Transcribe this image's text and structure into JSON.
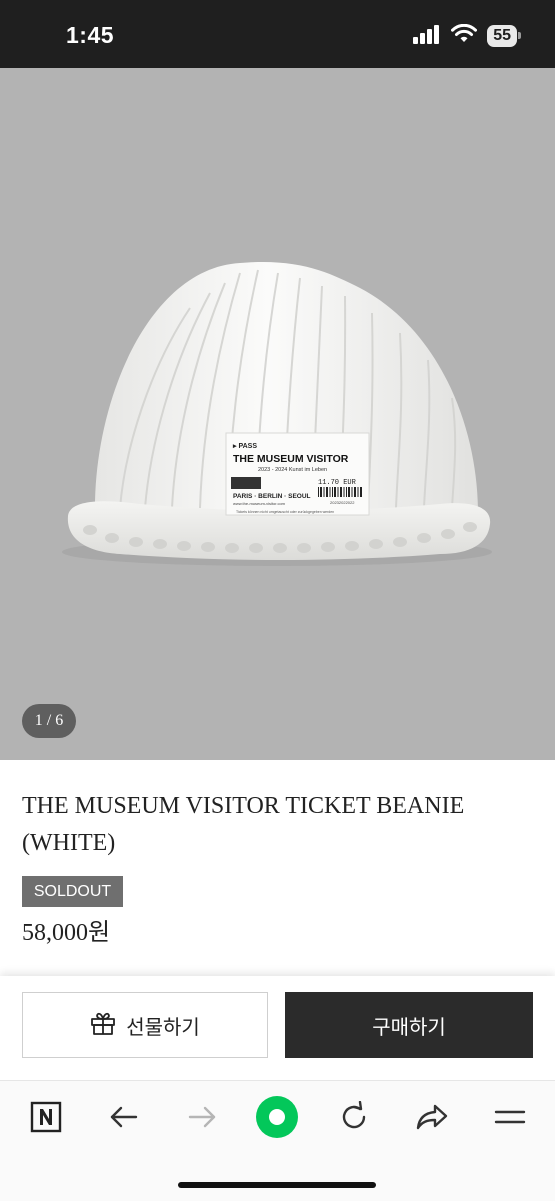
{
  "status_bar": {
    "time": "1:45",
    "battery": "55",
    "icons": [
      "cellular-signal-icon",
      "wifi-icon",
      "battery-icon"
    ]
  },
  "gallery": {
    "counter": "1 / 6",
    "label_text": {
      "pass": "▸ PASS",
      "title": "THE MUSEUM VISITOR",
      "subtitle": "2023 - 2024  Kunst im Leben",
      "price": "11.70  EUR",
      "cities": "PARIS · BERLIN · SEOUL",
      "url": "www.the-museum-visitor.com",
      "code": "20232022022",
      "fine_print": "Tickets können nicht umgetauscht oder zurückgegeben werden"
    }
  },
  "product": {
    "title": "THE MUSEUM VISITOR TICKET BEANIE (WHITE)",
    "badge": "SOLDOUT",
    "price": "58,000원"
  },
  "actions": {
    "gift_label": "선물하기",
    "buy_label": "구매하기"
  },
  "browser_toolbar": {
    "buttons": [
      "naver-n-icon",
      "back-arrow-icon",
      "forward-arrow-icon",
      "home-circle-icon",
      "reload-icon",
      "share-icon",
      "menu-icon"
    ]
  },
  "colors": {
    "status_bar_bg": "#1f1f1f",
    "hero_bg": "#b3b3b3",
    "soldout_bg": "#6f6f6f",
    "buy_bg": "#2b2b2b",
    "accent_green": "#03c75a"
  }
}
